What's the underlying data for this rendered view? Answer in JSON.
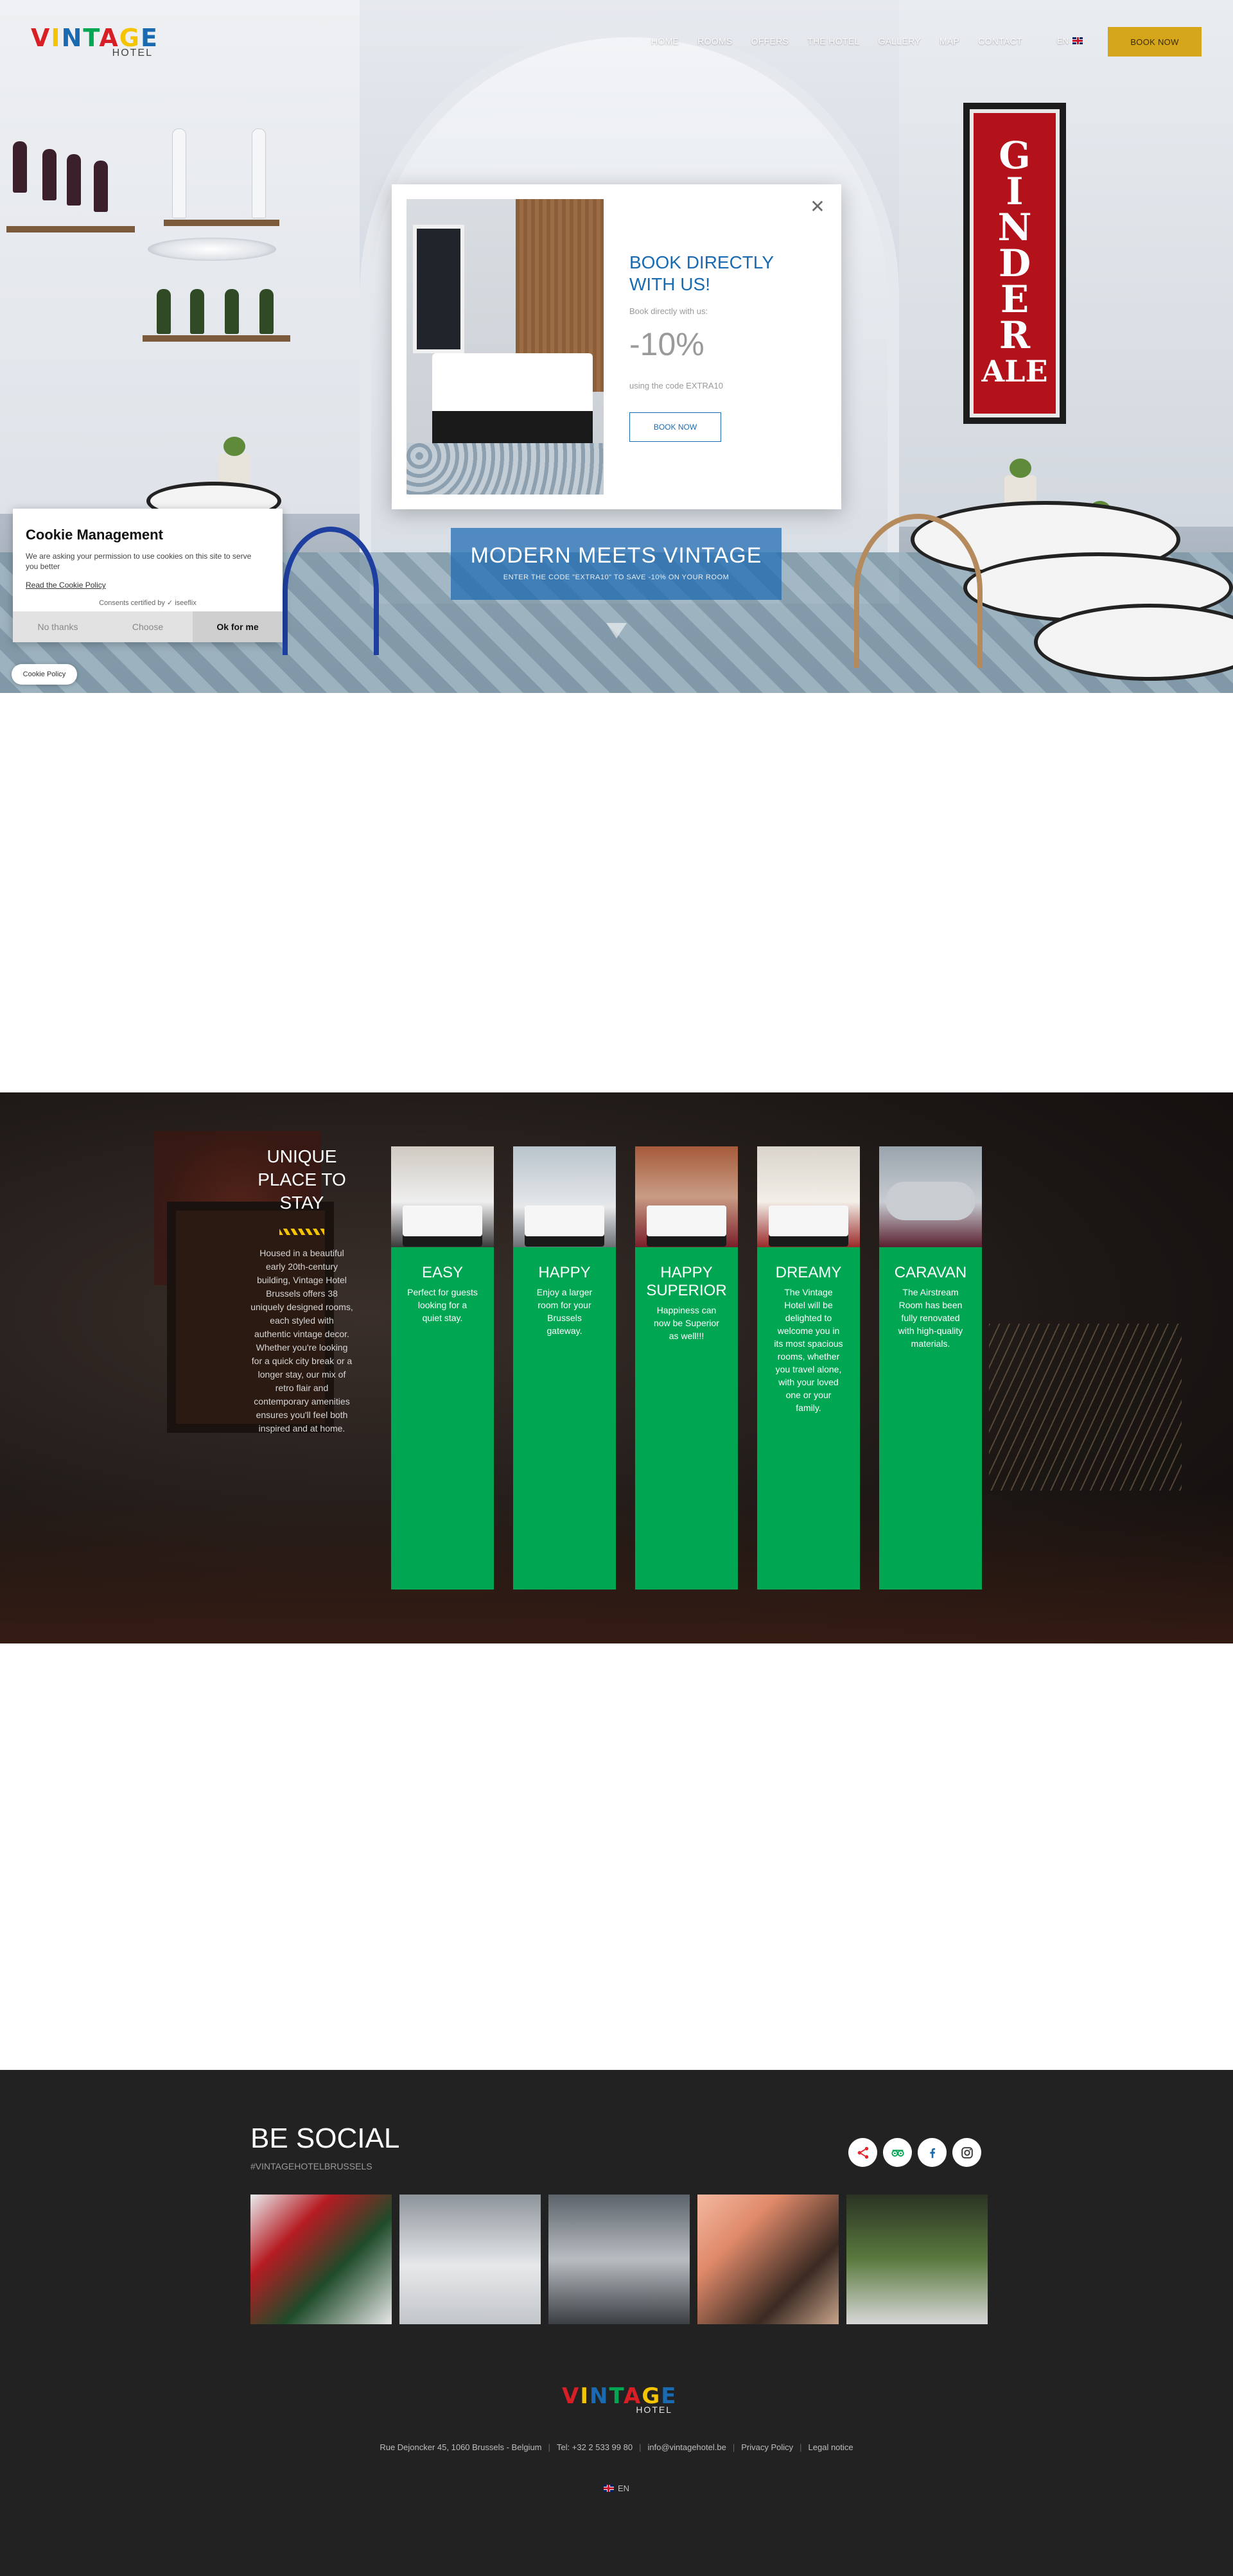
{
  "header": {
    "logo_word": "VINTAGE",
    "logo_sub": "HOTEL",
    "nav": [
      "HOME",
      "ROOMS",
      "OFFERS",
      "THE HOTEL",
      "GALLERY",
      "MAP",
      "CONTACT"
    ],
    "lang": "EN",
    "book_now": "BOOK NOW"
  },
  "hero": {
    "sign_letters": [
      "G",
      "I",
      "N",
      "D",
      "E",
      "R",
      "ALE"
    ],
    "banner_title": "MODERN MEETS VINTAGE",
    "banner_subtitle": "ENTER THE CODE \"EXTRA10\" TO SAVE -10% ON YOUR ROOM"
  },
  "popup": {
    "title": "BOOK DIRECTLY WITH US!",
    "subtitle": "Book directly with us:",
    "discount": "-10%",
    "code_text": "using the code EXTRA10",
    "button": "BOOK NOW",
    "close_glyph": "✕"
  },
  "cookie": {
    "title": "Cookie Management",
    "text": "We are asking your permission to use cookies on this site to serve you better",
    "link": "Read the Cookie Policy",
    "certified": "Consents certified by ✓ iseeflix",
    "btn_no": "No thanks",
    "btn_choose": "Choose",
    "btn_ok": "Ok for me",
    "policy_button": "Cookie Policy"
  },
  "rooms": {
    "title": "UNIQUE PLACE TO STAY",
    "description": "Housed in a beautiful early 20th-century building, Vintage Hotel Brussels offers 38 uniquely designed rooms, each styled with authentic vintage decor. Whether you're looking for a quick city break or a longer stay, our mix of retro flair and contemporary amenities ensures you'll feel both inspired and at home.",
    "cards": [
      {
        "title": "EASY",
        "text": "Perfect for guests looking for a quiet stay.",
        "bg": "linear-gradient(180deg,#cfcac2 0%,#efefef 55%,#3a3a3a 100%)"
      },
      {
        "title": "HAPPY",
        "text": "Enjoy a larger room for your Brussels gateway.",
        "bg": "linear-gradient(180deg,#b9c4cc 0%,#e6e8ea 60%,#6b6f73 100%)"
      },
      {
        "title": "HAPPY SUPERIOR",
        "text": "Happiness can now be Superior as well!!!",
        "bg": "linear-gradient(180deg,#a65b3a 0%,#c99c85 50%,#7a1f2a 100%)"
      },
      {
        "title": "DREAMY",
        "text": "The Vintage Hotel will be delighted to welcome you in its most spacious rooms, whether you travel alone, with your loved one or your family.",
        "bg": "linear-gradient(180deg,#d9d4cc 0%,#f3efe8 55%,#9a2a2a 100%)"
      },
      {
        "title": "CARAVAN",
        "text": "The Airstream Room has been fully renovated with high-quality materials.",
        "bg": "linear-gradient(180deg,#9aa4ad 0%,#c7ccd1 55%,#5a2030 100%)"
      }
    ]
  },
  "social": {
    "title": "BE SOCIAL",
    "hashtag": "#VINTAGEHOTELBRUSSELS",
    "icons": [
      "share-icon",
      "tripadvisor-icon",
      "facebook-icon",
      "instagram-icon"
    ],
    "tiles": [
      "linear-gradient(135deg,#e9ecef 0%,#b51c22 30%,#1f4b2a 60%,#e8e8e8 100%)",
      "linear-gradient(180deg,#8d949b 0%,#e6e8ea 55%,#c3c6c9 100%)",
      "linear-gradient(180deg,#5c636a 0%,#b8bdc2 50%,#3b3f44 100%)",
      "linear-gradient(135deg,#f2b8a0 0%,#e08a6a 30%,#3a2a22 70%,#c9a48a 100%)",
      "linear-gradient(180deg,#2b3324 0%,#5a7a3e 50%,#d8d8d8 100%)"
    ]
  },
  "footer": {
    "logo_word": "VINTAGE",
    "logo_sub": "HOTEL",
    "address": "Rue Dejoncker 45, 1060 Brussels - Belgium",
    "tel": "Tel: +32 2 533 99 80",
    "email": "info@vintagehotel.be",
    "privacy": "Privacy Policy",
    "legal": "Legal notice",
    "lang": "EN"
  },
  "colors": {
    "accent_blue": "#1a6ab2",
    "book_gold": "#d6a61a",
    "room_green": "#00a652",
    "footer_bg": "#222222",
    "logo_letters": [
      "#d81f26",
      "#f4c400",
      "#1a6ab2",
      "#00a652",
      "#d81f26",
      "#f4c400",
      "#1a6ab2"
    ]
  }
}
